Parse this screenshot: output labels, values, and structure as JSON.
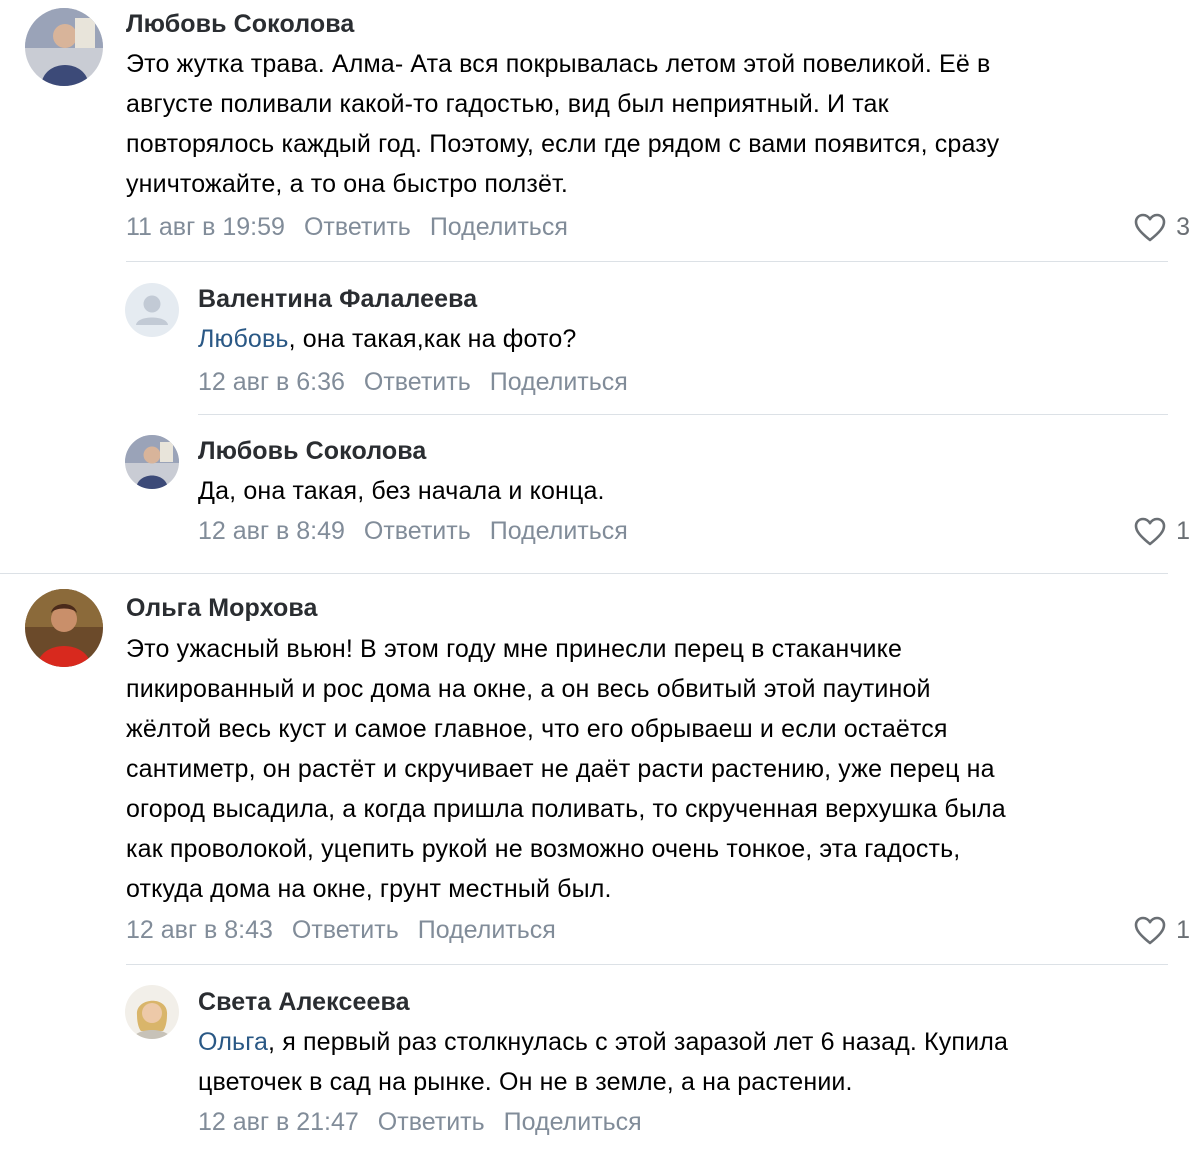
{
  "comments": [
    {
      "author": "Любовь Соколова",
      "text_lines": [
        "Это жутка трава. Алма- Ата вся покрывалась летом этой повеликой. Её в",
        "августе поливали какой-то гадостью, вид был неприятный. И так",
        "повторялось каждый год. Поэтому, если где рядом с вами появится, сразу",
        "уничтожайте, а то она быстро ползёт."
      ],
      "date": "11 авг в 19:59",
      "reply_label": "Ответить",
      "share_label": "Поделиться",
      "likes": "3"
    },
    {
      "author": "Валентина Фалалеева",
      "mention": "Любовь",
      "text_rest": ", она такая,как на фото?",
      "date": "12 авг в 6:36",
      "reply_label": "Ответить",
      "share_label": "Поделиться"
    },
    {
      "author": "Любовь Соколова",
      "text_lines": [
        "Да, она такая, без начала и конца."
      ],
      "date": "12 авг в 8:49",
      "reply_label": "Ответить",
      "share_label": "Поделиться",
      "likes": "1"
    },
    {
      "author": "Ольга Морхова",
      "text_lines": [
        "Это ужасный вьюн! В этом году мне принесли перец в стаканчике",
        "пикированный и рос дома на окне, а он весь обвитый этой паутиной",
        "жёлтой весь куст и самое главное, что его обрываеш и если остаётся",
        "сантиметр, он растёт и скручивает не даёт расти растению, уже перец на",
        "огород высадила, а когда пришла поливать, то скрученная верхушка была",
        "как проволокой, уцепить рукой не возможно очень тонкое, эта гадость,",
        "откуда дома на окне, грунт местный был."
      ],
      "date": "12 авг в 8:43",
      "reply_label": "Ответить",
      "share_label": "Поделиться",
      "likes": "1"
    },
    {
      "author": "Света Алексеева",
      "mention": "Ольга",
      "text_rest": ", я первый раз столкнулась с этой заразой лет 6 назад. Купила",
      "text_line2": "цветочек в сад на рынке. Он не в земле, а на растении.",
      "date": "12 авг в 21:47",
      "reply_label": "Ответить",
      "share_label": "Поделиться"
    }
  ],
  "colors": {
    "text": "#000000",
    "author": "#2a2d31",
    "meta": "#818c99",
    "mention": "#2a5885",
    "divider": "#dce1e6"
  },
  "icons": {
    "like": "heart-outline-icon",
    "placeholder_avatar": "person-silhouette-icon"
  }
}
